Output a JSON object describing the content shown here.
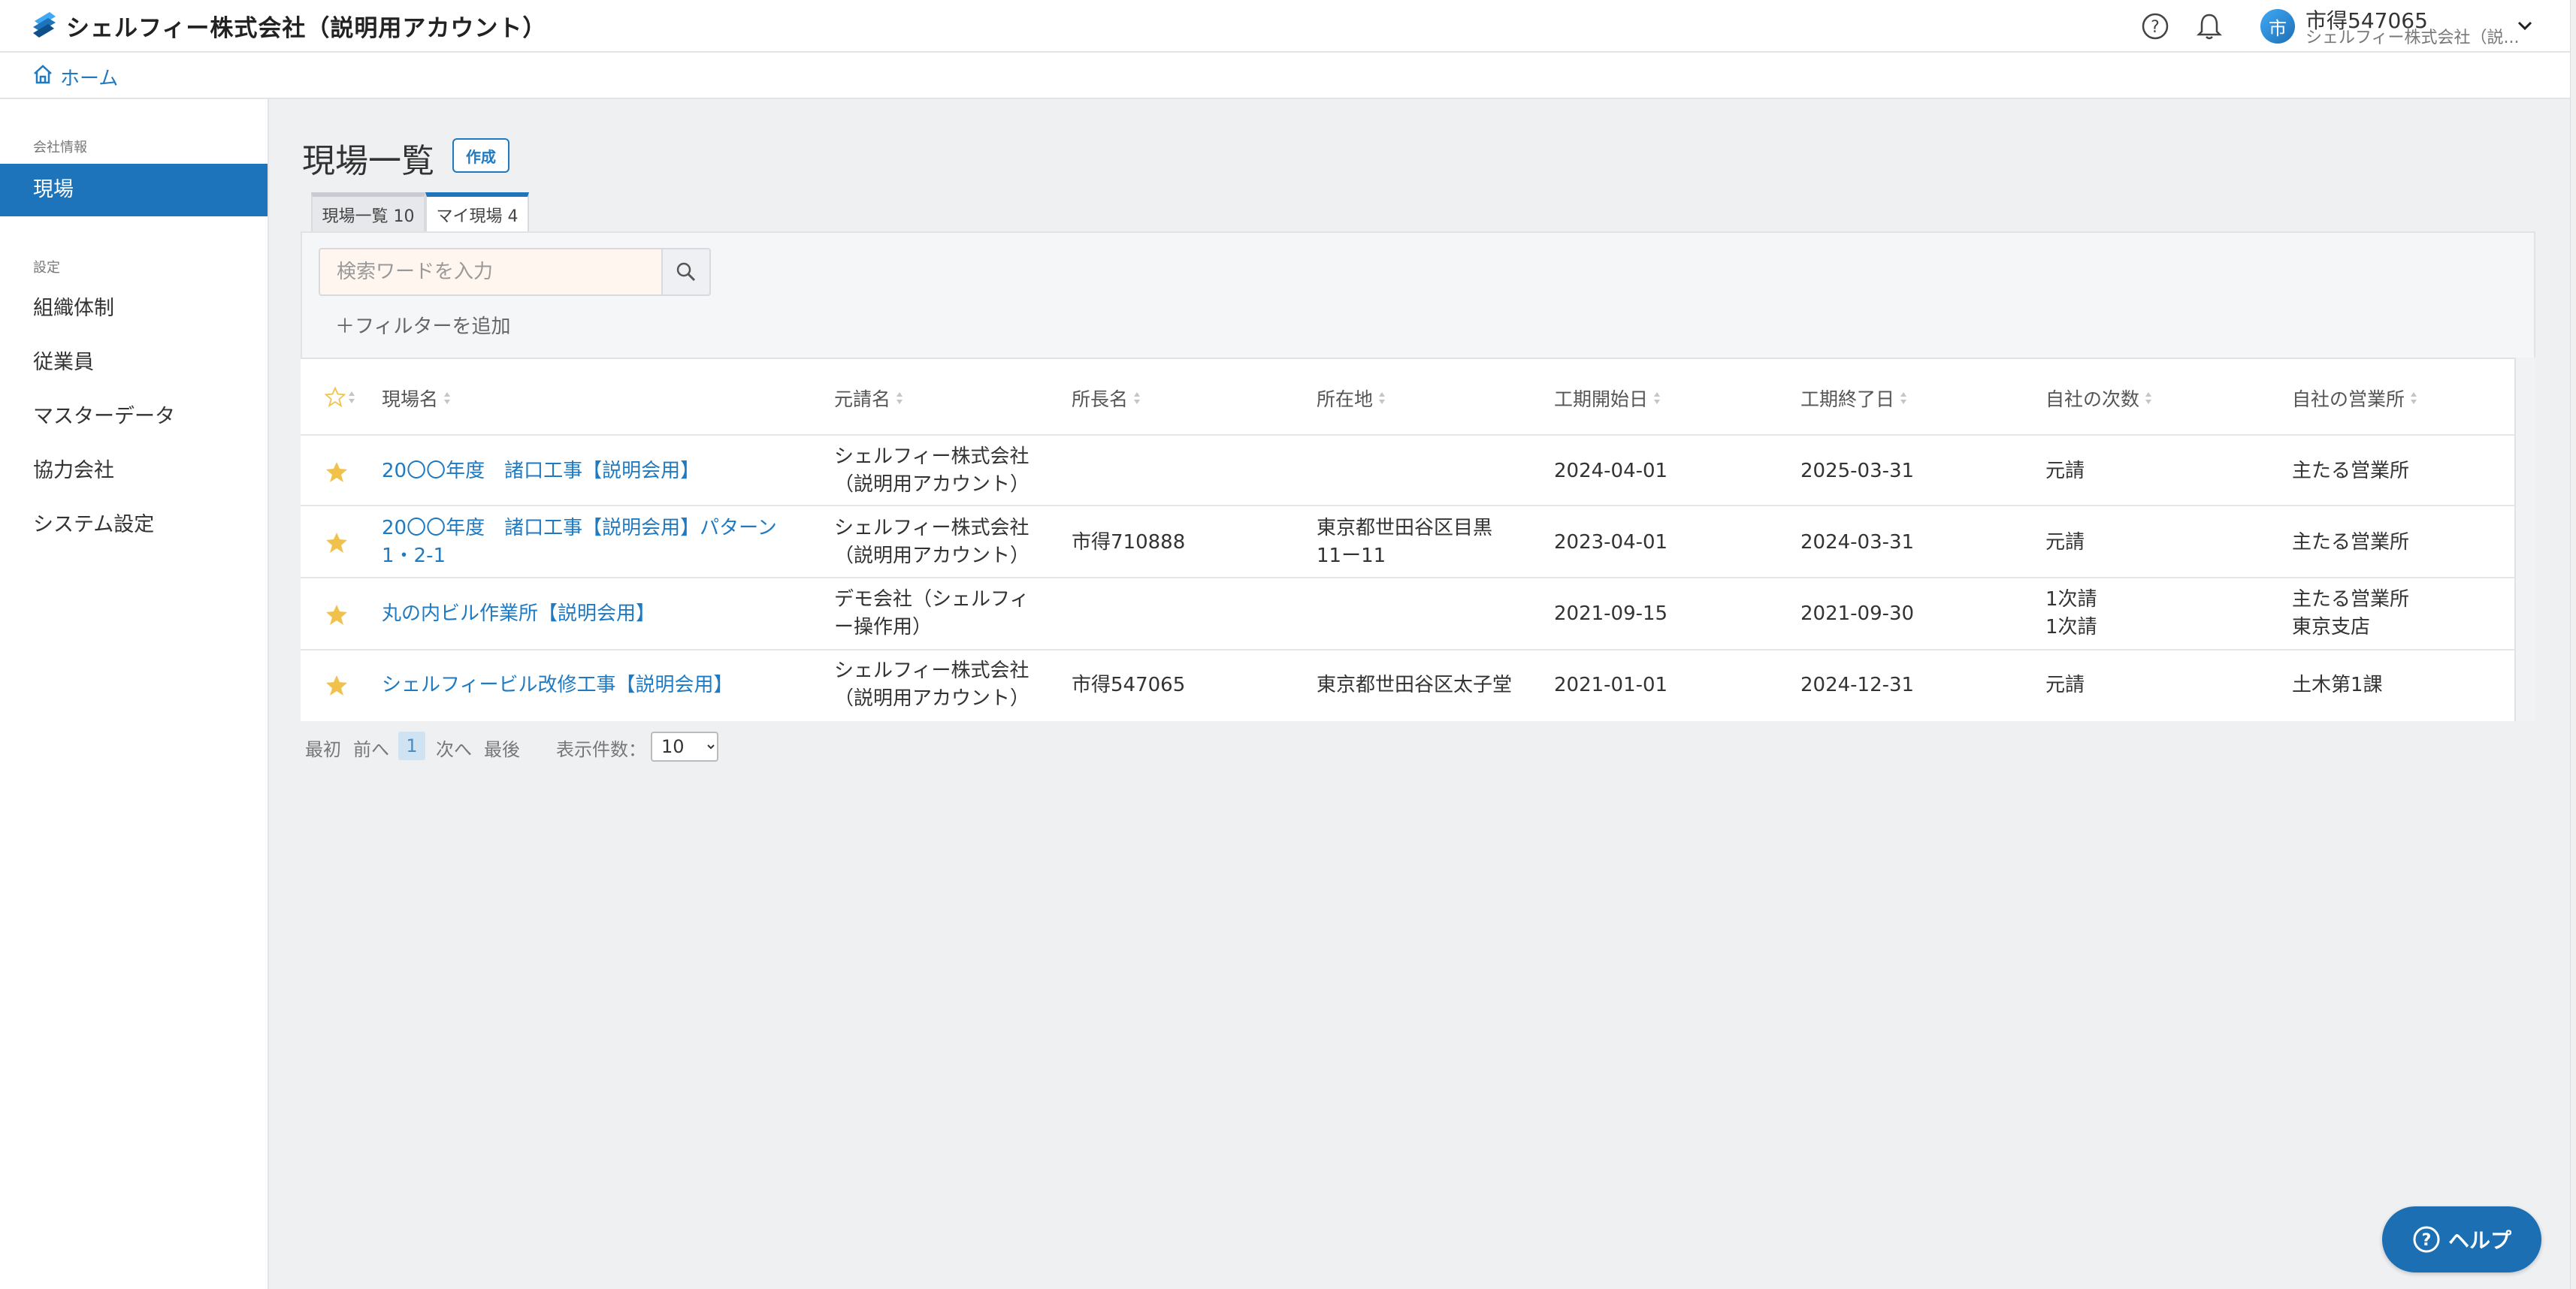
{
  "header": {
    "company_title": "シェルフィー株式会社（説明用アカウント）",
    "user_avatar_char": "市",
    "user_name": "市得547065",
    "user_company": "シェルフィー株式会社（説..."
  },
  "breadcrumb": {
    "home_label": "ホーム"
  },
  "sidebar": {
    "section1_heading": "会社情報",
    "section2_heading": "設定",
    "items": [
      {
        "label": "現場"
      },
      {
        "label": "組織体制"
      },
      {
        "label": "従業員"
      },
      {
        "label": "マスターデータ"
      },
      {
        "label": "協力会社"
      },
      {
        "label": "システム設定"
      }
    ]
  },
  "main": {
    "page_title": "現場一覧",
    "create_label": "作成",
    "tabs": [
      {
        "label": "現場一覧 10"
      },
      {
        "label": "マイ現場 4"
      }
    ],
    "search_placeholder": "検索ワードを入力",
    "add_filter_label": "＋フィルターを追加",
    "columns": [
      "現場名",
      "元請名",
      "所長名",
      "所在地",
      "工期開始日",
      "工期終了日",
      "自社の次数",
      "自社の営業所"
    ],
    "rows": [
      {
        "site": "20〇〇年度　諸口工事【説明会用】",
        "site2": "",
        "contractor": "シェルフィー株式会社",
        "contractor2": "（説明用アカウント）",
        "manager": "",
        "location": "",
        "location2": "",
        "start": "2024-04-01",
        "end": "2025-03-31",
        "tier": "元請",
        "tier2": "",
        "office": "主たる営業所",
        "office2": ""
      },
      {
        "site": "20〇〇年度　諸口工事【説明会用】パターン",
        "site2": "1・2-1",
        "contractor": "シェルフィー株式会社",
        "contractor2": "（説明用アカウント）",
        "manager": "市得710888",
        "location": "東京都世田谷区目黒",
        "location2": "11ー11",
        "start": "2023-04-01",
        "end": "2024-03-31",
        "tier": "元請",
        "tier2": "",
        "office": "主たる営業所",
        "office2": ""
      },
      {
        "site": "丸の内ビル作業所【説明会用】",
        "site2": "",
        "contractor": "デモ会社（シェルフィ",
        "contractor2": "ー操作用）",
        "manager": "",
        "location": "",
        "location2": "",
        "start": "2021-09-15",
        "end": "2021-09-30",
        "tier": "1次請",
        "tier2": "1次請",
        "office": "主たる営業所",
        "office2": "東京支店"
      },
      {
        "site": "シェルフィービル改修工事【説明会用】",
        "site2": "",
        "contractor": "シェルフィー株式会社",
        "contractor2": "（説明用アカウント）",
        "manager": "市得547065",
        "location": "東京都世田谷区太子堂",
        "location2": "",
        "start": "2021-01-01",
        "end": "2024-12-31",
        "tier": "元請",
        "tier2": "",
        "office": "土木第1課",
        "office2": ""
      }
    ],
    "pager": {
      "first": "最初",
      "prev": "前へ",
      "current": "1",
      "next": "次へ",
      "last": "最後",
      "per_page_label": "表示件数：",
      "per_page_value": "10"
    }
  },
  "help_button_label": "ヘルプ",
  "colors": {
    "accent": "#1d74bb",
    "link": "#1f7ac1",
    "star": "#f1c24b"
  }
}
